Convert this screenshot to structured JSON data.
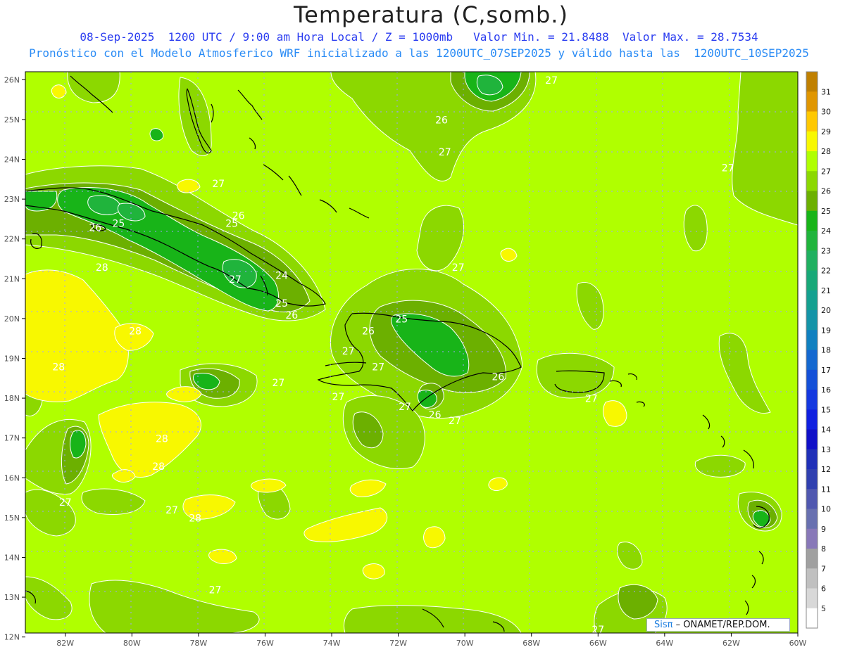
{
  "header": {
    "title": "Temperatura (C,somb.)",
    "subtitle1": "08-Sep-2025  1200 UTC / 9:00 am Hora Local / Z = 1000mb   Valor Min. = 21.8488  Valor Max. = 28.7534",
    "subtitle2": "Pronóstico con el Modelo Atmosferico WRF inicializado a las 1200UTC_07SEP2025 y válido hasta las  1200UTC_10SEP2025"
  },
  "axes": {
    "lat_labels": [
      "26N",
      "25N",
      "24N",
      "23N",
      "22N",
      "21N",
      "20N",
      "19N",
      "18N",
      "17N",
      "16N",
      "15N",
      "14N",
      "13N",
      "12N"
    ],
    "lon_labels": [
      "82W",
      "80W",
      "78W",
      "76W",
      "74W",
      "72W",
      "70W",
      "68W",
      "66W",
      "64W",
      "62W",
      "60W"
    ]
  },
  "colorbar": {
    "labels": [
      "31",
      "30",
      "29",
      "28",
      "27",
      "26",
      "25",
      "24",
      "23",
      "22",
      "21",
      "20",
      "19",
      "18",
      "17",
      "16",
      "15",
      "14",
      "13",
      "12",
      "11",
      "10",
      "9",
      "8",
      "7",
      "6",
      "5"
    ],
    "colors": [
      "#c08000",
      "#e09600",
      "#ffc800",
      "#f8f800",
      "#b0ff00",
      "#8cd800",
      "#6cb000",
      "#18b418",
      "#20b43c",
      "#20b060",
      "#18a878",
      "#14a090",
      "#1494a8",
      "#1080c0",
      "#1468d0",
      "#1450d8",
      "#1438e0",
      "#1020e0",
      "#1010c8",
      "#2030b8",
      "#3040b0",
      "#5058b0",
      "#6870b0",
      "#8878b8",
      "#a0a0a0",
      "#c0c0c0",
      "#d8d8d8",
      "#ffffff"
    ]
  },
  "map_labels": [
    {
      "text": "27",
      "lon": -77.4,
      "lat": 23.3
    },
    {
      "text": "26",
      "lon": -76.8,
      "lat": 22.5
    },
    {
      "text": "25",
      "lon": -77.0,
      "lat": 22.3
    },
    {
      "text": "25",
      "lon": -80.4,
      "lat": 22.3
    },
    {
      "text": "26",
      "lon": -81.1,
      "lat": 22.2
    },
    {
      "text": "24",
      "lon": -75.5,
      "lat": 21.0
    },
    {
      "text": "25",
      "lon": -75.5,
      "lat": 20.3
    },
    {
      "text": "26",
      "lon": -75.2,
      "lat": 20.0
    },
    {
      "text": "27",
      "lon": -76.9,
      "lat": 20.9
    },
    {
      "text": "28",
      "lon": -80.9,
      "lat": 21.2
    },
    {
      "text": "28",
      "lon": -79.9,
      "lat": 19.6
    },
    {
      "text": "28",
      "lon": -82.2,
      "lat": 18.7
    },
    {
      "text": "27",
      "lon": -75.6,
      "lat": 18.3
    },
    {
      "text": "27",
      "lon": -73.5,
      "lat": 19.1
    },
    {
      "text": "27",
      "lon": -72.6,
      "lat": 18.7
    },
    {
      "text": "26",
      "lon": -72.9,
      "lat": 19.6
    },
    {
      "text": "25",
      "lon": -71.9,
      "lat": 19.9
    },
    {
      "text": "27",
      "lon": -73.8,
      "lat": 17.95
    },
    {
      "text": "27",
      "lon": -71.8,
      "lat": 17.7
    },
    {
      "text": "26",
      "lon": -70.9,
      "lat": 17.5
    },
    {
      "text": "27",
      "lon": -70.3,
      "lat": 17.35
    },
    {
      "text": "26",
      "lon": -69.0,
      "lat": 18.45
    },
    {
      "text": "26",
      "lon": -70.7,
      "lat": 24.9
    },
    {
      "text": "27",
      "lon": -70.6,
      "lat": 24.1
    },
    {
      "text": "27",
      "lon": -70.2,
      "lat": 21.2
    },
    {
      "text": "27",
      "lon": -67.4,
      "lat": 25.9
    },
    {
      "text": "27",
      "lon": -62.1,
      "lat": 23.7
    },
    {
      "text": "27",
      "lon": -66.2,
      "lat": 17.9
    },
    {
      "text": "28",
      "lon": -79.1,
      "lat": 16.9
    },
    {
      "text": "28",
      "lon": -79.2,
      "lat": 16.2
    },
    {
      "text": "27",
      "lon": -82.0,
      "lat": 15.3
    },
    {
      "text": "27",
      "lon": -78.8,
      "lat": 15.1
    },
    {
      "text": "28",
      "lon": -78.1,
      "lat": 14.9
    },
    {
      "text": "27",
      "lon": -77.5,
      "lat": 13.1
    },
    {
      "text": "27",
      "lon": -66.0,
      "lat": 12.1
    }
  ],
  "credit": {
    "logo": "Sisπ",
    "text": "– ONAMET/REP.DOM."
  }
}
